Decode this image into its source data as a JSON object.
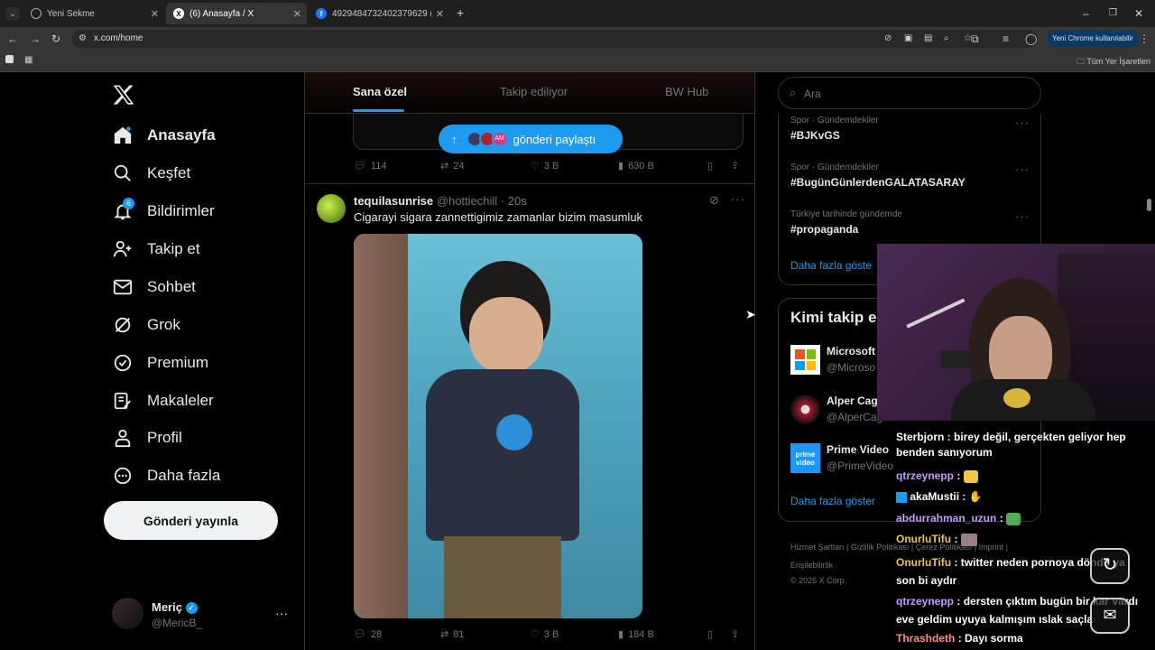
{
  "browser": {
    "tabs": [
      {
        "title": "Yeni Sekme"
      },
      {
        "title": "(6) Anasayfa / X"
      },
      {
        "title": "4929484732402379629 (200×2..."
      }
    ],
    "url": "x.com/home",
    "chrome_update_label": "Yeni Chrome kullanılabilir",
    "bookmarks_all_label": "Tüm Yer İşaretleri"
  },
  "nav": {
    "items": [
      {
        "label": "Anasayfa"
      },
      {
        "label": "Keşfet"
      },
      {
        "label": "Bildirimler",
        "badge": "6"
      },
      {
        "label": "Takip et"
      },
      {
        "label": "Sohbet"
      },
      {
        "label": "Grok"
      },
      {
        "label": "Premium"
      },
      {
        "label": "Makaleler"
      },
      {
        "label": "Profil"
      },
      {
        "label": "Daha fazla"
      }
    ],
    "post_button": "Gönderi yayınla",
    "user": {
      "name": "Meriç",
      "handle": "@MericB_"
    }
  },
  "feed": {
    "tabs": [
      "Sana özel",
      "Takip ediliyor",
      "BW Hub"
    ],
    "share_pill": "gönderi paylaştı",
    "post1_stats": {
      "replies": "114",
      "reposts": "24",
      "likes": "3 B",
      "views": "630 B"
    },
    "post2": {
      "name": "tequilasunrise",
      "handle": "@hottiechill",
      "time": "· 20s",
      "text": "Cigarayi sigara zannettigimiz zamanlar bizim masumluk",
      "stats": {
        "replies": "28",
        "reposts": "81",
        "likes": "3 B",
        "views": "184 B"
      }
    }
  },
  "right": {
    "search_placeholder": "Ara",
    "trends": [
      {
        "category": "Spor · Gündemdekiler",
        "tag": "#BJKvGS"
      },
      {
        "category": "Spor · Gündemdekiler",
        "tag": "#BugünGünlerdenGALATASARAY"
      },
      {
        "category": "Türkiye tarihinde gündemde",
        "tag": "#propaganda"
      }
    ],
    "show_more": "Daha fazla göste",
    "who_to_follow_title": "Kimi takip e",
    "follow": [
      {
        "name": "Microsoft",
        "handle": "@Microso"
      },
      {
        "name": "Alper Cag",
        "handle": "@AlperCag"
      },
      {
        "name": "Prime Video",
        "handle": "@PrimeVideo"
      }
    ],
    "show_more2": "Daha fazla göster",
    "footer": [
      "Hizmet Şartları",
      "Gizlilik Politikası",
      "Çerez Politikası",
      "Imprint",
      "Erişilebilirlik",
      "© 2026 X Corp."
    ]
  },
  "chat": [
    {
      "user": "",
      "msg": "Sterbjorn : birey değil, gerçekten geliyor hep benden sanıyorum",
      "color": "#ffffff"
    },
    {
      "user": "qtrzeynepp",
      "msg": ":",
      "color": "#c39cff"
    },
    {
      "user": "akaMustii",
      "msg": ":",
      "color": "#ffffff"
    },
    {
      "user": "abdurrahman_uzun",
      "msg": ":",
      "color": "#c39cff"
    },
    {
      "user": "OnurluTifu",
      "msg": ":",
      "color": "#e8c35a"
    },
    {
      "user": "OnurluTifu",
      "msg": ": twitter neden pornoya döndü ya son bi aydır",
      "color": "#e8c35a"
    },
    {
      "user": "qtrzeynepp",
      "msg": ": dersten çıktım bugün bir kar vardı eve geldim uyuya kalmışım ıslak saçla",
      "color": "#c39cff"
    },
    {
      "user": "Thrashdeth",
      "msg": ": Dayı sorma",
      "color": "#ff8a8a"
    }
  ]
}
